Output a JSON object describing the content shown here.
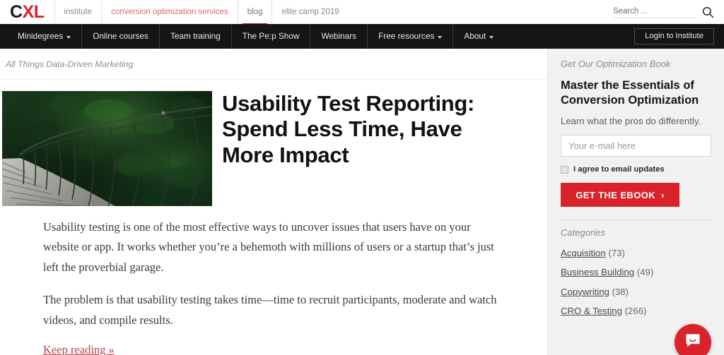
{
  "header": {
    "logo": {
      "part1": "C",
      "part2": "XL"
    },
    "top_links": [
      {
        "label": "institute",
        "style": "muted"
      },
      {
        "label": "conversion optimization services",
        "style": "pink"
      },
      {
        "label": "blog",
        "style": "active"
      },
      {
        "label": "elite camp 2019",
        "style": "muted"
      }
    ],
    "search": {
      "placeholder": "Search ...",
      "value": "",
      "icon": "search-icon"
    }
  },
  "nav": {
    "items": [
      {
        "label": "Minidegrees",
        "caret": true
      },
      {
        "label": "Online courses",
        "caret": false
      },
      {
        "label": "Team training",
        "caret": false
      },
      {
        "label": "The Pe:p Show",
        "caret": false
      },
      {
        "label": "Webinars",
        "caret": false
      },
      {
        "label": "Free resources",
        "caret": true
      },
      {
        "label": "About",
        "caret": true
      }
    ],
    "login_label": "Login to Institute"
  },
  "main": {
    "tagline": "All Things Data-Driven Marketing",
    "hero_alt": "suspension-bridge-in-forest",
    "headline": "Usability Test Reporting: Spend Less Time, Have More Impact",
    "paragraph_1": "Usability testing is one of the most effective ways to uncover issues that users have on your website or app. It works whether you’re a behemoth with millions of users or a startup that’s just left the proverbial garage.",
    "paragraph_2": "The problem is that usability testing takes time—time to recruit participants, moderate and watch videos, and compile results.",
    "keep_reading": "Keep reading »"
  },
  "sidebar": {
    "ebook": {
      "kicker": "Get Our Optimization Book",
      "title": "Master the Essentials of Conversion Optimization",
      "subtitle": "Learn what the pros do differently.",
      "email_placeholder": "Your e-mail here",
      "email_value": "",
      "agree_label": "I agree to email updates",
      "button_label": "GET THE EBOOK",
      "button_chevron": "›"
    },
    "categories": {
      "heading": "Categories",
      "items": [
        {
          "label": "Acquisition",
          "count": "(73)"
        },
        {
          "label": "Business Building",
          "count": "(49)"
        },
        {
          "label": "Copywriting",
          "count": "(38)"
        },
        {
          "label": "CRO & Testing",
          "count": "(266)"
        }
      ]
    }
  },
  "chat": {
    "icon": "chat-bubble-icon"
  },
  "colors": {
    "brand_red": "#d8232a",
    "nav_dark": "#151515",
    "sidebar_bg": "#f1f1f1",
    "link_red": "#b5424c"
  }
}
